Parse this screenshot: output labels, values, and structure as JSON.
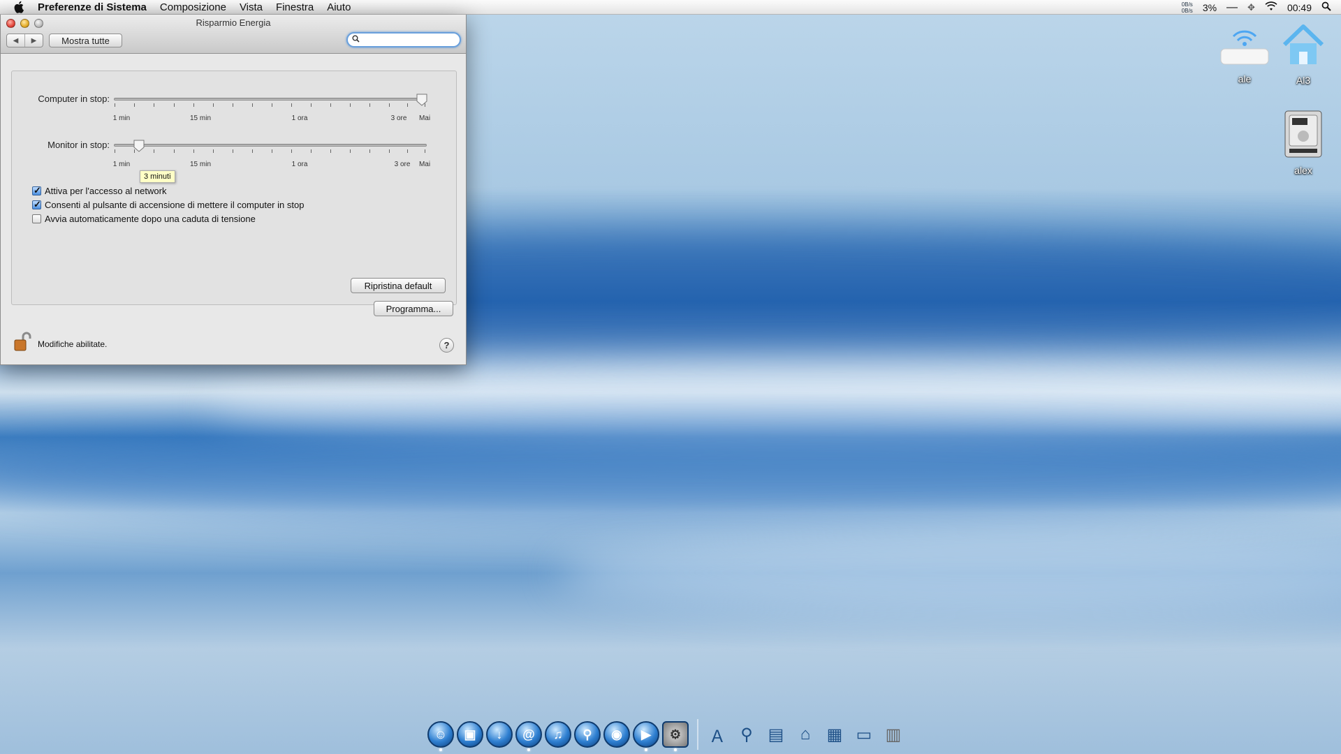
{
  "menubar": {
    "app_name": "Preferenze di Sistema",
    "items": [
      "Composizione",
      "Vista",
      "Finestra",
      "Aiuto"
    ],
    "net_up": "0B/s",
    "net_down": "0B/s",
    "cpu": "3%",
    "clock": "00:49"
  },
  "window": {
    "title": "Risparmio Energia",
    "show_all_label": "Mostra tutte",
    "search_value": "",
    "search_placeholder": "",
    "computer_sleep": {
      "label": "Computer in stop:",
      "ticks": [
        "1 min",
        "15 min",
        "1 ora",
        "3 ore",
        "Mai"
      ],
      "value": "Mai",
      "position_fraction": 1.0
    },
    "display_sleep": {
      "label": "Monitor in stop:",
      "ticks": [
        "1 min",
        "15 min",
        "1 ora",
        "3 ore",
        "Mai"
      ],
      "tooltip": "3 minuti",
      "position_fraction": 0.08
    },
    "options": [
      {
        "label": "Attiva per l'accesso al network",
        "checked": true
      },
      {
        "label": "Consenti al pulsante di accensione di mettere il computer in stop",
        "checked": true
      },
      {
        "label": "Avvia automaticamente dopo una caduta di tensione",
        "checked": false
      }
    ],
    "restore_defaults_label": "Ripristina default",
    "schedule_label": "Programma...",
    "lock_text": "Modifiche abilitate.",
    "help_label": "?"
  },
  "desktop_icons": [
    {
      "name": "ale",
      "icon": "airport-base-station-icon"
    },
    {
      "name": "Al3",
      "icon": "home-folder-icon"
    },
    {
      "name": "alex",
      "icon": "hard-drive-icon"
    }
  ],
  "dock": {
    "apps": [
      {
        "icon": "finder-icon",
        "running": true
      },
      {
        "icon": "facetime-icon",
        "running": false
      },
      {
        "icon": "downloads-icon",
        "running": false
      },
      {
        "icon": "spiral-app-icon",
        "running": true
      },
      {
        "icon": "itunes-icon",
        "running": false
      },
      {
        "icon": "spotlight-icon",
        "running": false
      },
      {
        "icon": "eye-app-icon",
        "running": false
      },
      {
        "icon": "quicktime-icon",
        "running": true
      },
      {
        "icon": "system-preferences-icon",
        "running": true
      }
    ],
    "stacks": [
      "applications-icon",
      "search-folder-icon",
      "documents-icon",
      "home-icon",
      "network-folder-icon",
      "drive-icon",
      "trash-icon"
    ]
  }
}
